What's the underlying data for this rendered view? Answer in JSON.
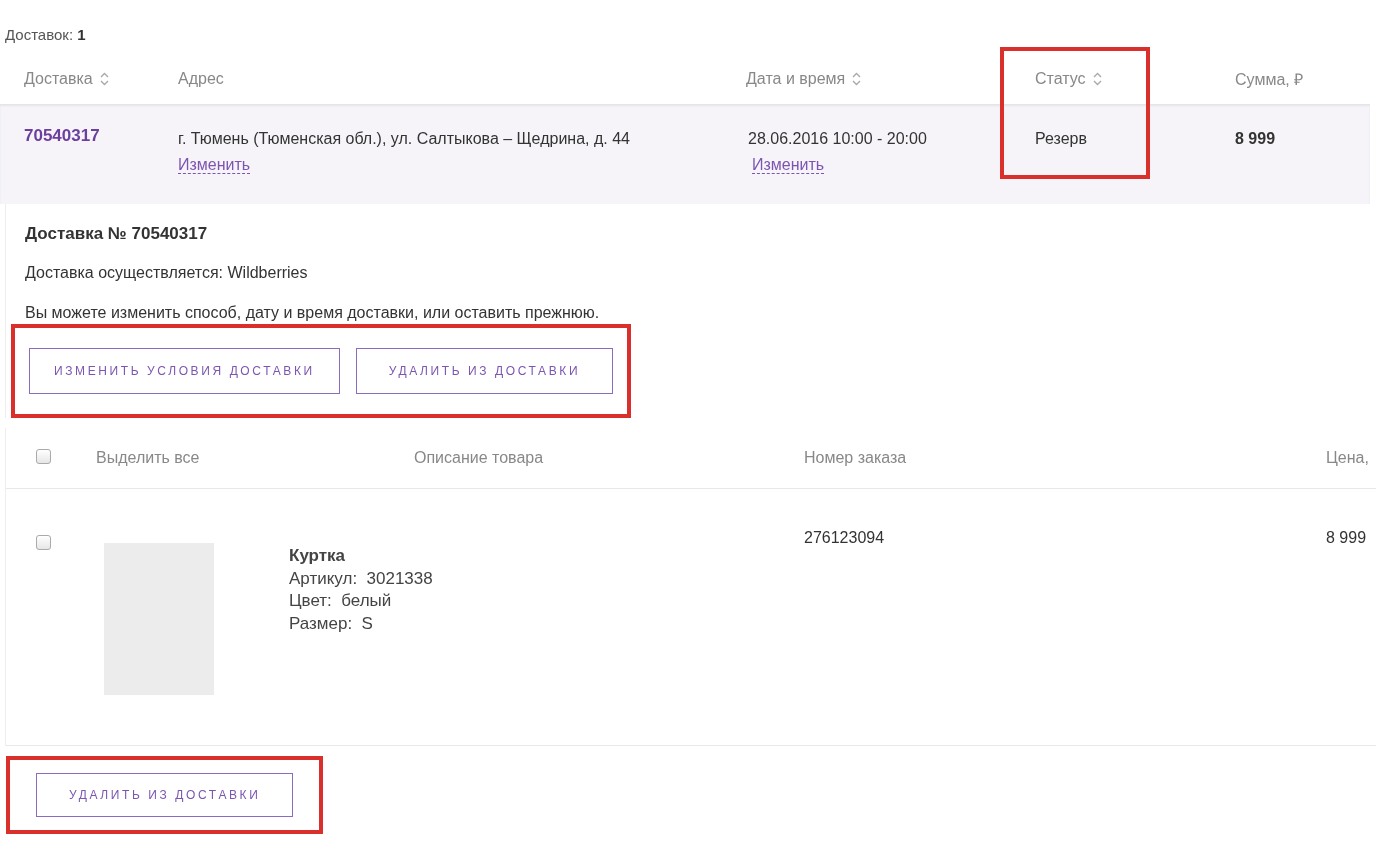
{
  "summary": {
    "label": "Доставок:",
    "count": "1"
  },
  "deliveries_table": {
    "columns": [
      {
        "label": "Доставка",
        "sortable": true,
        "highlighted": false
      },
      {
        "label": "Адрес",
        "sortable": false,
        "highlighted": false
      },
      {
        "label": "Дата и время",
        "sortable": true,
        "highlighted": false
      },
      {
        "label": "Статус",
        "sortable": true,
        "highlighted": true
      },
      {
        "label": "Сумма, ₽",
        "sortable": false,
        "highlighted": false
      }
    ],
    "rows": [
      {
        "number": "70540317",
        "address": "г. Тюмень (Тюменская обл.), ул. Салтыкова – Щедрина, д. 44",
        "address_link": "Изменить",
        "datetime": "28.06.2016 10:00 - 20:00",
        "datetime_link": "Изменить",
        "status": "Резерв",
        "sum": "8 999"
      }
    ]
  },
  "delivery_details": {
    "title": "Доставка № 70540317",
    "carrier": "Доставка осуществляется: Wildberries",
    "note": "Вы можете изменить способ, дату и время доставки, или оставить прежнюю.",
    "highlighted": true,
    "buttons": [
      "ИЗМЕНИТЬ УСЛОВИЯ ДОСТАВКИ",
      "УДАЛИТЬ ИЗ ДОСТАВКИ"
    ]
  },
  "items_table": {
    "select_all": {
      "label": "Выделить все",
      "checked": false
    },
    "columns": [
      "Описание товара",
      "Номер заказа",
      "Цена,"
    ],
    "rows": [
      {
        "checked": false,
        "name": "Куртка",
        "details": [
          {
            "label": "Артикул:",
            "value": "3021338"
          },
          {
            "label": "Цвет:",
            "value": "белый"
          },
          {
            "label": "Размер:",
            "value": "S"
          }
        ],
        "order": "276123094",
        "price": "8 999"
      }
    ]
  },
  "bottom_action": {
    "label": "УДАЛИТЬ ИЗ ДОСТАВКИ",
    "highlighted": true
  }
}
